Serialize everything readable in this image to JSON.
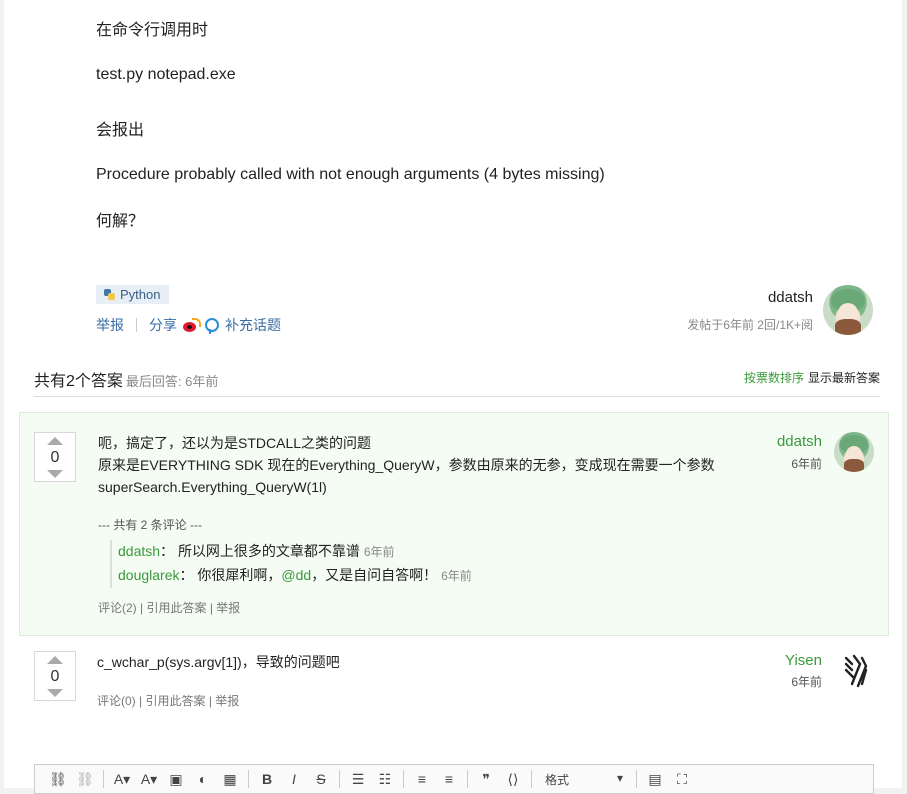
{
  "question": {
    "lines": [
      "在命令行调用时",
      "test.py notepad.exe",
      "会报出",
      "Procedure probably called with not enough arguments (4 bytes missing)",
      "何解？"
    ],
    "tag": "Python",
    "actions": {
      "report": "举报",
      "share": "分享",
      "add_topic": "补充话题"
    },
    "author": "ddatsh",
    "meta": "发帖于6年前 2回/1K+阅"
  },
  "answers_header": {
    "title": "共有2个答案",
    "last_reply": "最后回答: 6年前",
    "sort_by_votes": "按票数排序",
    "sort_newest": "显示最新答案"
  },
  "answers": [
    {
      "votes": "0",
      "lines": [
        "呃，搞定了，还以为是STDCALL之类的问题",
        "原来是EVERYTHING SDK 现在的Everything_QueryW，参数由原来的无参，变成现在需要一个参数",
        "superSearch.Everything_QueryW(1l)"
      ],
      "author": "ddatsh",
      "time": "6年前",
      "comment_header": "--- 共有 2 条评论 ---",
      "comments": [
        {
          "user": "ddatsh",
          "text": "所以网上很多的文章都不靠谱",
          "mention": "",
          "text2": "",
          "time": "6年前"
        },
        {
          "user": "douglarek",
          "text": "你很犀利啊，",
          "mention": "@dd",
          "text2": "，又是自问自答啊！",
          "time": "6年前"
        }
      ],
      "links": {
        "comments": "评论(2)",
        "quote": "引用此答案",
        "report": "举报"
      }
    },
    {
      "votes": "0",
      "lines": [
        "c_wchar_p(sys.argv[1])，导致的问题吧"
      ],
      "author": "Yisen",
      "time": "6年前",
      "links": {
        "comments": "评论(0)",
        "quote": "引用此答案",
        "report": "举报"
      }
    }
  ],
  "editor": {
    "format_label": "格式"
  },
  "colors": {
    "accent_green": "#3b9a3b",
    "link_blue": "#3a6ea5",
    "answer_bg": "#f4fcf4"
  }
}
